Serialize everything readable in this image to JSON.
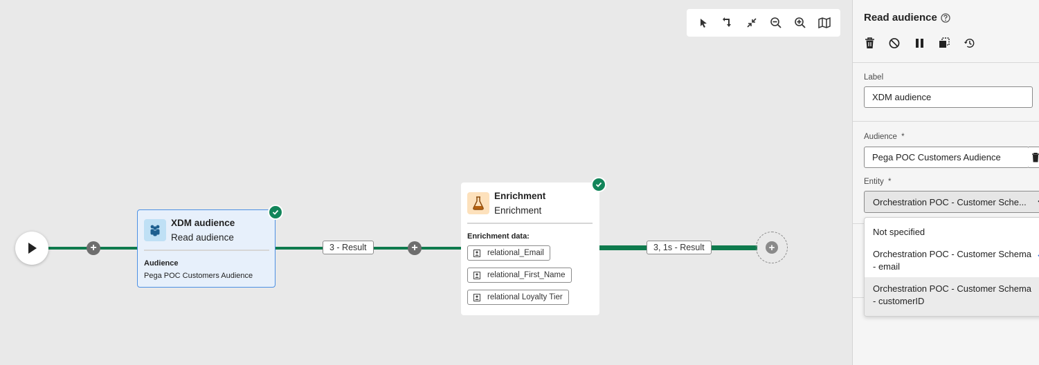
{
  "canvas": {
    "toolbar": {
      "icons": [
        "pointer-icon",
        "auto-arrange-icon",
        "collapse-icon",
        "zoom-out-icon",
        "zoom-in-icon",
        "map-icon"
      ]
    },
    "transitions": {
      "first_result": "3 - Result",
      "second_result": "3, 1s - Result"
    },
    "nodes": {
      "audience": {
        "title": "XDM audience",
        "subtitle": "Read audience",
        "detail_label": "Audience",
        "detail_value": "Pega POC Customers Audience"
      },
      "enrichment": {
        "title": "Enrichment",
        "subtitle": "Enrichment",
        "section_label": "Enrichment data:",
        "attributes": [
          "relational_Email",
          "relational_First_Name",
          "relational Loyalty Tier"
        ]
      }
    }
  },
  "panel": {
    "title": "Read audience",
    "actions": [
      "delete-icon",
      "disable-icon",
      "pause-icon",
      "copy-icon",
      "history-icon"
    ],
    "label_field": {
      "label": "Label",
      "value": "XDM audience"
    },
    "audience_field": {
      "label": "Audience",
      "required": "*",
      "value": "Pega POC Customers Audience"
    },
    "entity_field": {
      "label": "Entity",
      "required": "*",
      "value": "Orchestration POC - Customer Sche...",
      "options": [
        "Not specified",
        "Orchestration POC - Customer Schema - email",
        "Orchestration POC - Customer Schema - customerID"
      ],
      "option_lines": {
        "opt0": "Not specified",
        "opt1a": "Orchestration POC - Customer Schema",
        "opt1b": "- email",
        "opt2a": "Orchestration POC - Customer Schema",
        "opt2b": "- customerID"
      },
      "selected_index": 1,
      "hovered_index": 2
    }
  },
  "colors": {
    "connector": "#0e7a4d",
    "success": "#12855a",
    "selected_border": "#4b8fe3",
    "selected_bg": "#e7f0fb",
    "check_accent": "#2c6fd1"
  }
}
